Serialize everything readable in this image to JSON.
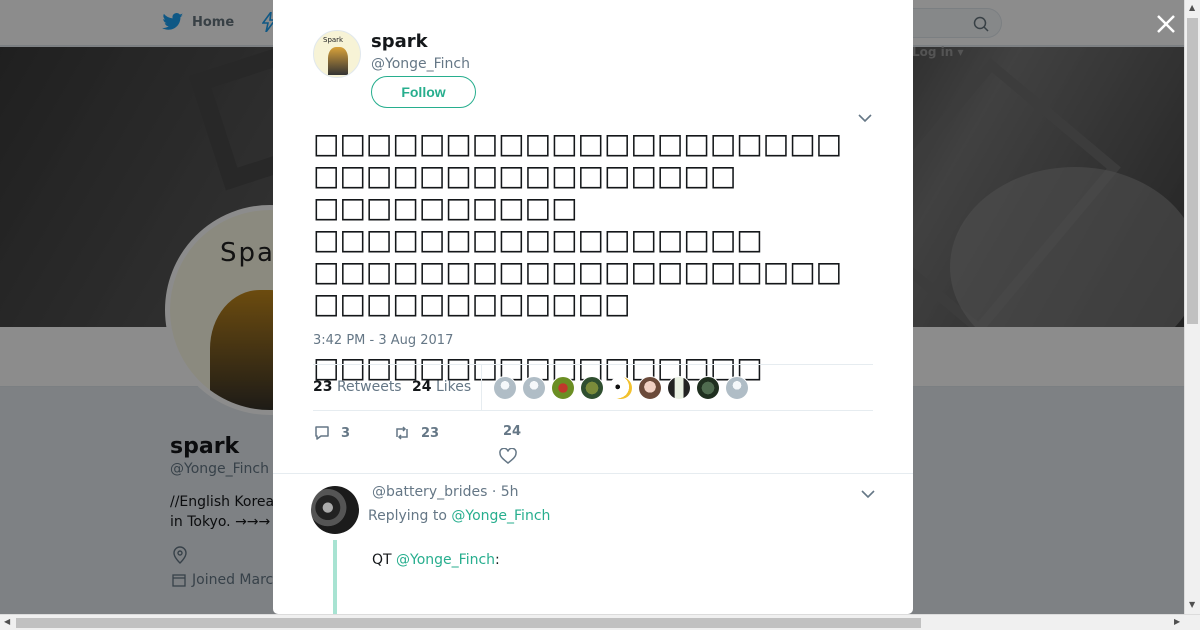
{
  "background": {
    "nav": {
      "home_label": "Home"
    },
    "login_label": "Log in",
    "profile": {
      "name": "spark",
      "handle": "@Yonge_Finch",
      "bio": "//English Korea in Tokyo. →→→",
      "joined": "Joined Marc",
      "avatar_text": "Spar"
    }
  },
  "tweet": {
    "author_name": "spark",
    "author_handle": "@Yonge_Finch",
    "avatar_text": "Spark",
    "follow_label": "Follow",
    "text_lines": [
      "□□□□□□□□□□□□□□□□□□□□□□□□□□□□□□□□□□□□",
      "□□□□□□□□□□",
      "□□□□□□□□□□□□□□□□□",
      "□□□□□□□□□□□□□□□□□□□□□□□□□□□□□□□□",
      "",
      "□□□□□□□□□□□□□□□□□"
    ],
    "timestamp": "3:42 PM - 3 Aug 2017",
    "retweets_count": "23",
    "retweets_label": "Retweets",
    "likes_count": "24",
    "likes_label": "Likes",
    "likers": [
      "default-grey",
      "default-grey",
      "red-photo",
      "green-photo",
      "panda",
      "face-photo",
      "bottle-photo",
      "leaf-photo",
      "default-grey"
    ],
    "actions": {
      "replies": "3",
      "retweets": "23",
      "likes": "24"
    }
  },
  "reply": {
    "handle": "@battery_brides · 5h",
    "replying_prefix": "Replying to",
    "replying_to": "@Yonge_Finch",
    "qt_prefix": "QT",
    "qt_handle": "@Yonge_Finch",
    "qt_suffix": ":"
  },
  "colors": {
    "accent": "#27ae8e",
    "text": "#14171a",
    "muted": "#657786"
  }
}
